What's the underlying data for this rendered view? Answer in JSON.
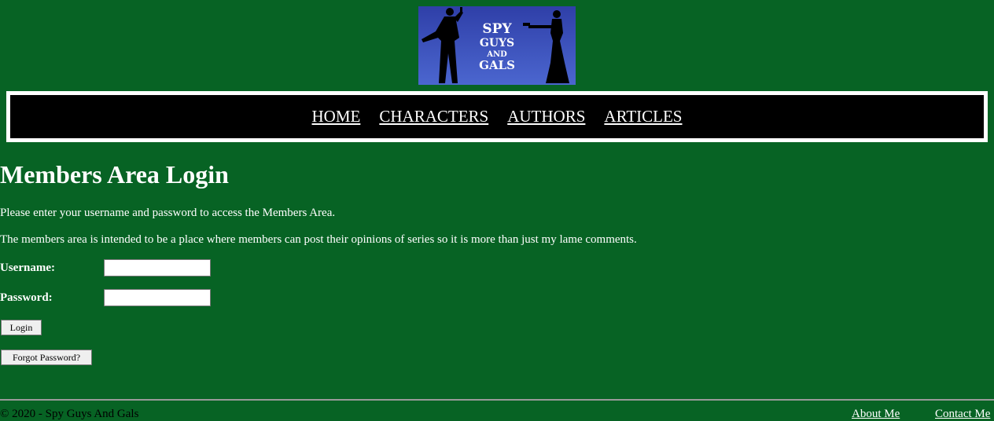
{
  "logo": {
    "line1": "SPY",
    "line2": "GUYS",
    "line3": "AND",
    "line4": "GALS"
  },
  "nav": {
    "home": "HOME",
    "characters": "CHARACTERS",
    "authors": "AUTHORS",
    "articles": "ARTICLES"
  },
  "main": {
    "title": "Members Area Login",
    "intro": "Please enter your username and password to access the Members Area.",
    "description": "The members area is intended to be a place where members can post their opinions of series so it is more than just my lame comments.",
    "username_label": "Username:",
    "password_label": "Password:",
    "username_value": "",
    "password_value": "",
    "login_label": "Login",
    "forgot_label": "Forgot Password?"
  },
  "footer": {
    "copyright": "© 2020 - Spy Guys And Gals",
    "about": "About Me",
    "contact": "Contact Me"
  },
  "colors": {
    "background": "#076324",
    "nav_bg": "#000000",
    "logo_bg": "#3a4fb8"
  }
}
